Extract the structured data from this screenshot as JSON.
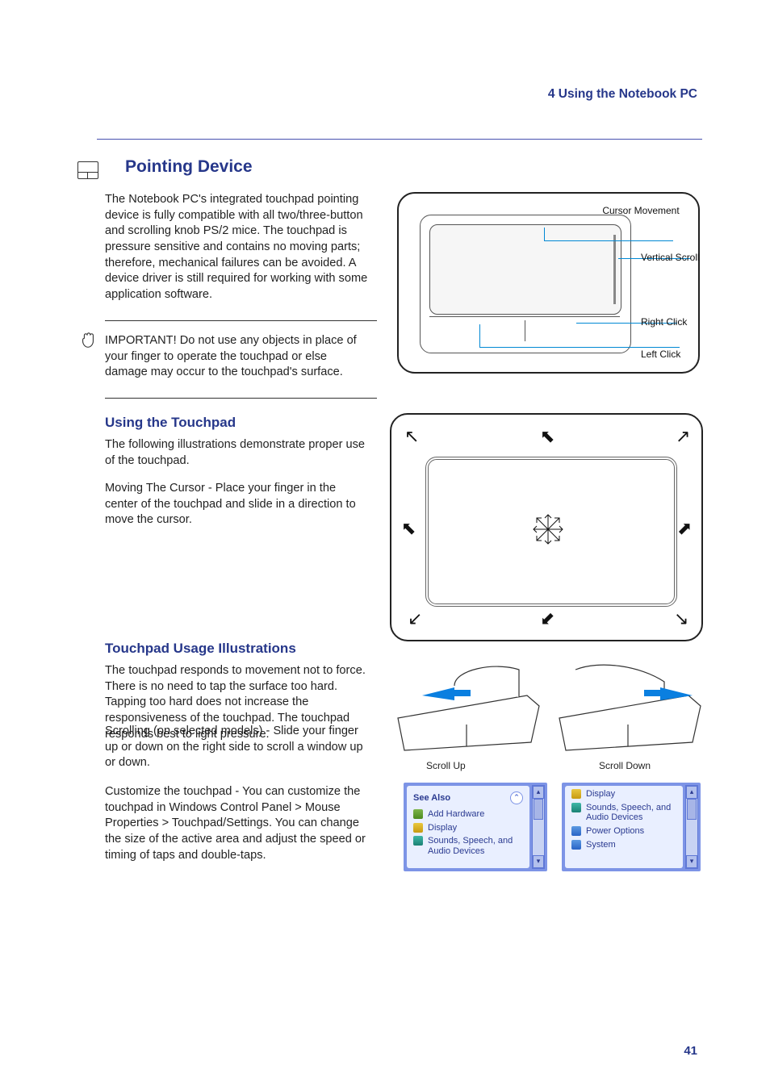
{
  "chapter_header": "4    Using the Notebook PC",
  "section_title": "Pointing Device",
  "body": {
    "b1": "The Notebook PC's integrated touchpad pointing device is fully compatible with all two/three-button and scrolling knob PS/2 mice. The touchpad is pressure sensitive and contains no moving parts; therefore, mechanical failures can be avoided. A device driver is still required for working with some application software.",
    "b2": "IMPORTANT! Do not use any objects in place of your finger to operate the touchpad or else damage may occur to the touchpad's surface.",
    "b3": "The following illustrations demonstrate proper use of the touchpad.",
    "b4": "Moving The Cursor - Place your finger in the center of the touchpad and slide in a direction to move the cursor.",
    "b5": "The touchpad responds to movement not to force. There is no need to tap the surface too hard. Tapping too hard does not increase the responsiveness of the touchpad. The touchpad responds best to light pressure.",
    "b6": "Scrolling (on selected models) - Slide your finger up or down on the right side to scroll a window up or down.",
    "b7": "Customize the touchpad - You can customize the touchpad in Windows Control Panel > Mouse Properties > Touchpad/Settings. You can change the size of the active area and adjust the speed or timing of taps and double-taps."
  },
  "subhead": {
    "s1": "Using the Touchpad",
    "s2": "Touchpad Usage Illustrations"
  },
  "callouts": {
    "cursor_movement": "Cursor Movement",
    "vertical_scroll": "Vertical Scroll",
    "right_click": "Right Click",
    "left_click": "Left Click"
  },
  "scroll_labels": {
    "up": "Scroll Up",
    "down": "Scroll Down"
  },
  "xp_panels": {
    "a": {
      "title": "See Also",
      "items": [
        "Add Hardware",
        "Display",
        "Sounds, Speech, and Audio Devices"
      ]
    },
    "b": {
      "items": [
        "Display",
        "Sounds, Speech, and Audio Devices",
        "Power Options",
        "System"
      ]
    }
  },
  "page_number": "41"
}
